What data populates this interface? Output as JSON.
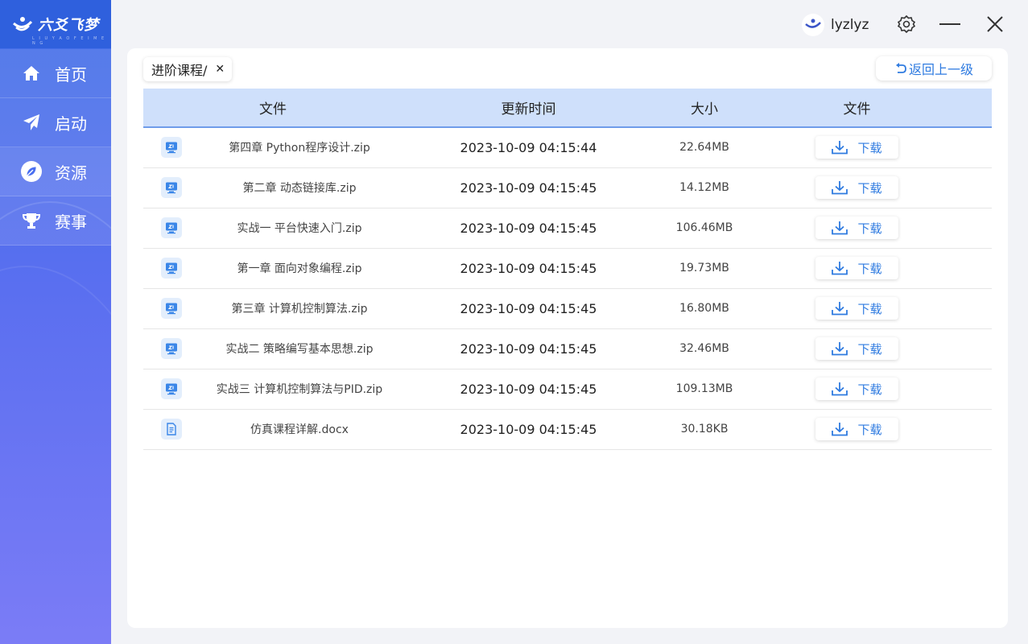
{
  "app": {
    "logo_text": "六爻飞梦",
    "logo_sub": "L I U  Y A O  F E I  M E N G"
  },
  "sidebar": {
    "items": [
      {
        "label": "首页",
        "icon": "home-icon"
      },
      {
        "label": "启动",
        "icon": "send-icon"
      },
      {
        "label": "资源",
        "icon": "leaf-icon"
      },
      {
        "label": "赛事",
        "icon": "trophy-icon"
      }
    ],
    "active_index": 2
  },
  "topbar": {
    "username": "lyzlyz"
  },
  "breadcrumb": {
    "path": "进阶课程/",
    "close": "✕"
  },
  "back_label": "返回上一级",
  "table": {
    "headers": [
      "文件",
      "更新时间",
      "大小",
      "文件"
    ],
    "download_label": "下载",
    "rows": [
      {
        "name": "第四章 Python程序设计.zip",
        "time": "2023-10-09 04:15:44",
        "size": "22.64MB",
        "type": "zip"
      },
      {
        "name": "第二章 动态链接库.zip",
        "time": "2023-10-09 04:15:45",
        "size": "14.12MB",
        "type": "zip"
      },
      {
        "name": "实战一 平台快速入门.zip",
        "time": "2023-10-09 04:15:45",
        "size": "106.46MB",
        "type": "zip"
      },
      {
        "name": "第一章 面向对象编程.zip",
        "time": "2023-10-09 04:15:45",
        "size": "19.73MB",
        "type": "zip"
      },
      {
        "name": "第三章 计算机控制算法.zip",
        "time": "2023-10-09 04:15:45",
        "size": "16.80MB",
        "type": "zip"
      },
      {
        "name": "实战二 策略编写基本思想.zip",
        "time": "2023-10-09 04:15:45",
        "size": "32.46MB",
        "type": "zip"
      },
      {
        "name": "实战三 计算机控制算法与PID.zip",
        "time": "2023-10-09 04:15:45",
        "size": "109.13MB",
        "type": "zip"
      },
      {
        "name": "仿真课程详解.docx",
        "time": "2023-10-09 04:15:45",
        "size": "30.18KB",
        "type": "doc"
      }
    ]
  },
  "colors": {
    "accent": "#2f7be0",
    "sidebar": "#4a6ff0",
    "header_bg": "#cfe0fb"
  }
}
